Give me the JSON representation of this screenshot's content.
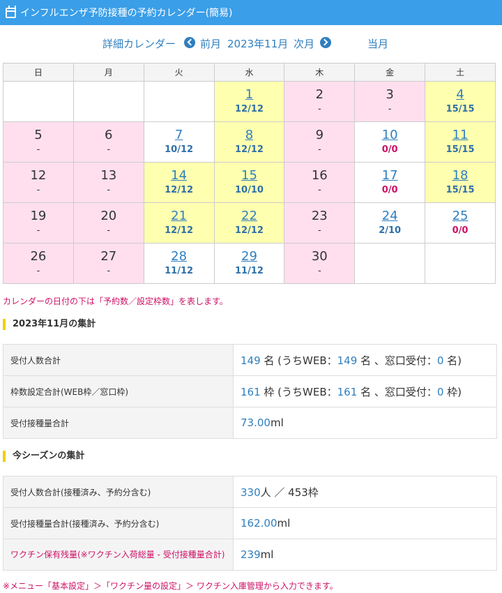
{
  "header": {
    "title": "インフルエンザ予防接種の予約カレンダー(簡易)",
    "icon": "calendar-icon"
  },
  "nav": {
    "detail": "詳細カレンダー",
    "prev": "前月",
    "month": "2023年11月",
    "next": "次月",
    "current": "当月"
  },
  "calendar": {
    "weekdays": [
      "日",
      "月",
      "火",
      "水",
      "木",
      "金",
      "土"
    ],
    "weeks": [
      [
        {
          "day": "",
          "count": "",
          "bg": "white"
        },
        {
          "day": "",
          "count": "",
          "bg": "white"
        },
        {
          "day": "",
          "count": "",
          "bg": "white"
        },
        {
          "day": "1",
          "count": "12/12",
          "bg": "yellow",
          "link": true
        },
        {
          "day": "2",
          "count": "-",
          "bg": "pink"
        },
        {
          "day": "3",
          "count": "-",
          "bg": "pink"
        },
        {
          "day": "4",
          "count": "15/15",
          "bg": "yellow",
          "link": true
        }
      ],
      [
        {
          "day": "5",
          "count": "-",
          "bg": "pink"
        },
        {
          "day": "6",
          "count": "-",
          "bg": "pink"
        },
        {
          "day": "7",
          "count": "10/12",
          "bg": "white",
          "link": true
        },
        {
          "day": "8",
          "count": "12/12",
          "bg": "yellow",
          "link": true
        },
        {
          "day": "9",
          "count": "-",
          "bg": "pink"
        },
        {
          "day": "10",
          "count": "0/0",
          "bg": "white",
          "link": true,
          "red": true
        },
        {
          "day": "11",
          "count": "15/15",
          "bg": "yellow",
          "link": true
        }
      ],
      [
        {
          "day": "12",
          "count": "-",
          "bg": "pink"
        },
        {
          "day": "13",
          "count": "-",
          "bg": "pink"
        },
        {
          "day": "14",
          "count": "12/12",
          "bg": "yellow",
          "link": true
        },
        {
          "day": "15",
          "count": "10/10",
          "bg": "yellow",
          "link": true
        },
        {
          "day": "16",
          "count": "-",
          "bg": "pink"
        },
        {
          "day": "17",
          "count": "0/0",
          "bg": "white",
          "link": true,
          "red": true
        },
        {
          "day": "18",
          "count": "15/15",
          "bg": "yellow",
          "link": true
        }
      ],
      [
        {
          "day": "19",
          "count": "-",
          "bg": "pink"
        },
        {
          "day": "20",
          "count": "-",
          "bg": "pink"
        },
        {
          "day": "21",
          "count": "12/12",
          "bg": "yellow",
          "link": true
        },
        {
          "day": "22",
          "count": "12/12",
          "bg": "yellow",
          "link": true
        },
        {
          "day": "23",
          "count": "-",
          "bg": "pink"
        },
        {
          "day": "24",
          "count": "2/10",
          "bg": "white",
          "link": true
        },
        {
          "day": "25",
          "count": "0/0",
          "bg": "white",
          "link": true,
          "red": true
        }
      ],
      [
        {
          "day": "26",
          "count": "-",
          "bg": "pink"
        },
        {
          "day": "27",
          "count": "-",
          "bg": "pink"
        },
        {
          "day": "28",
          "count": "11/12",
          "bg": "white",
          "link": true
        },
        {
          "day": "29",
          "count": "11/12",
          "bg": "white",
          "link": true
        },
        {
          "day": "30",
          "count": "-",
          "bg": "pink"
        },
        {
          "day": "",
          "count": "",
          "bg": "white"
        },
        {
          "day": "",
          "count": "",
          "bg": "white"
        }
      ]
    ]
  },
  "note": "カレンダーの日付の下は「予約数／設定枠数」を表します。",
  "monthly": {
    "title": "2023年11月の集計",
    "rows": [
      {
        "label": "受付人数合計",
        "parts": [
          {
            "n": "149"
          },
          {
            "t": " 名 (うちWEB："
          },
          {
            "n": "149"
          },
          {
            "t": " 名 、窓口受付："
          },
          {
            "n": "0"
          },
          {
            "t": " 名)"
          }
        ]
      },
      {
        "label": "枠数設定合計(WEB枠／窓口枠)",
        "parts": [
          {
            "n": "161"
          },
          {
            "t": " 枠 (うちWEB："
          },
          {
            "n": "161"
          },
          {
            "t": " 名 、窓口受付："
          },
          {
            "n": "0"
          },
          {
            "t": " 枠)"
          }
        ]
      },
      {
        "label": "受付接種量合計",
        "parts": [
          {
            "n": "73.00"
          },
          {
            "t": "ml"
          }
        ]
      }
    ]
  },
  "season": {
    "title": "今シーズンの集計",
    "rows": [
      {
        "label": "受付人数合計(接種済み、予約分含む)",
        "parts": [
          {
            "n": "330"
          },
          {
            "t": "人 ／ 453枠"
          }
        ]
      },
      {
        "label": "受付接種量合計(接種済み、予約分含む)",
        "parts": [
          {
            "n": "162.00"
          },
          {
            "t": "ml"
          }
        ]
      },
      {
        "label": "ワクチン保有残量(※ワクチン入荷総量 - 受付接種量合計)",
        "pink": true,
        "parts": [
          {
            "n": "239"
          },
          {
            "t": "ml"
          }
        ]
      }
    ]
  },
  "footer": "※メニュー「基本設定」＞「ワクチン量の設定」＞ ワクチン入庫管理から入力できます。",
  "colors": {
    "header": "#3a9ee8",
    "link": "#2f7fbf",
    "pink_cell": "#ffdfee",
    "yellow_cell": "#ffffb0",
    "accent_red": "#cc1166",
    "section_bar": "#f0d000"
  }
}
